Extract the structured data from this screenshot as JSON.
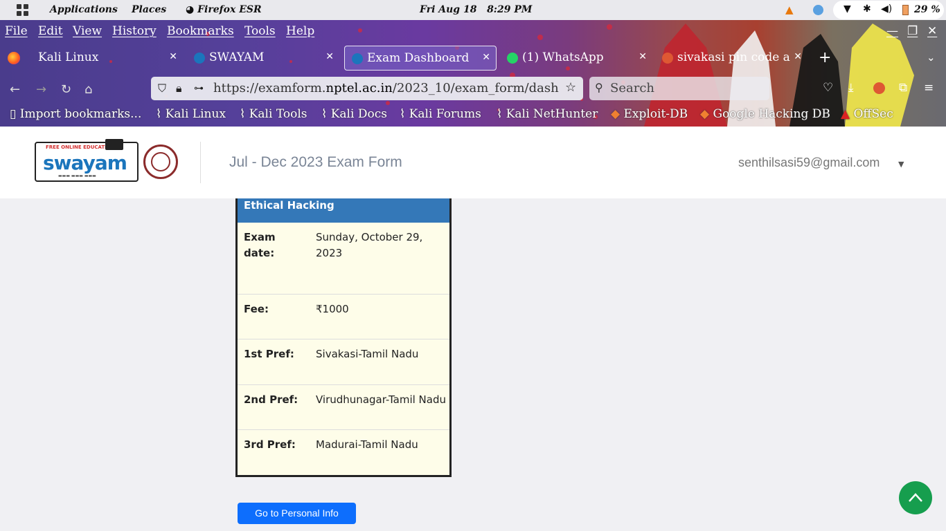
{
  "panel": {
    "applications": "Applications",
    "places": "Places",
    "firefox": "Firefox ESR",
    "clock": "Fri Aug 18   8:29 PM",
    "battery": "29 %"
  },
  "menubar": [
    "File",
    "Edit",
    "View",
    "History",
    "Bookmarks",
    "Tools",
    "Help"
  ],
  "tabs": [
    {
      "label": "Kali Linux",
      "icon": "firefox-icon"
    },
    {
      "label": "SWAYAM",
      "icon": "swayam-icon"
    },
    {
      "label": "Exam Dashboard",
      "icon": "swayam-icon"
    },
    {
      "label": "(1) WhatsApp",
      "icon": "whatsapp-icon"
    },
    {
      "label": "sivakasi pin code a",
      "icon": "duckduckgo-icon"
    }
  ],
  "url": {
    "prefix": "https://examform.",
    "domain": "nptel.ac.in",
    "path": "/2023_10/exam_form/dash"
  },
  "search_placeholder": "Search",
  "bookmarks": [
    "Import bookmarks...",
    "Kali Linux",
    "Kali Tools",
    "Kali Docs",
    "Kali Forums",
    "Kali NetHunter",
    "Exploit-DB",
    "Google Hacking DB",
    "OffSec"
  ],
  "header": {
    "logo_word": "swayam",
    "logo_top": "FREE ONLINE EDUCATION",
    "title": "Jul - Dec 2023 Exam Form",
    "email": "senthilsasi59@gmail.com"
  },
  "card": {
    "course": "Ethical Hacking",
    "rows": [
      {
        "key": "Exam date:",
        "value": "Sunday, October 29, 2023"
      },
      {
        "key": "Fee:",
        "value": "₹1000"
      },
      {
        "key": "1st Pref:",
        "value": "Sivakasi-Tamil Nadu"
      },
      {
        "key": "2nd Pref:",
        "value": "Virudhunagar-Tamil Nadu"
      },
      {
        "key": "3rd Pref:",
        "value": "Madurai-Tamil Nadu"
      }
    ]
  },
  "button": {
    "personal_info": "Go to Personal Info"
  },
  "colors": {
    "accent": "#0d6efd",
    "card_head": "#3478b8",
    "card_bg": "#fefde9",
    "scroll_top": "#169e4e"
  }
}
